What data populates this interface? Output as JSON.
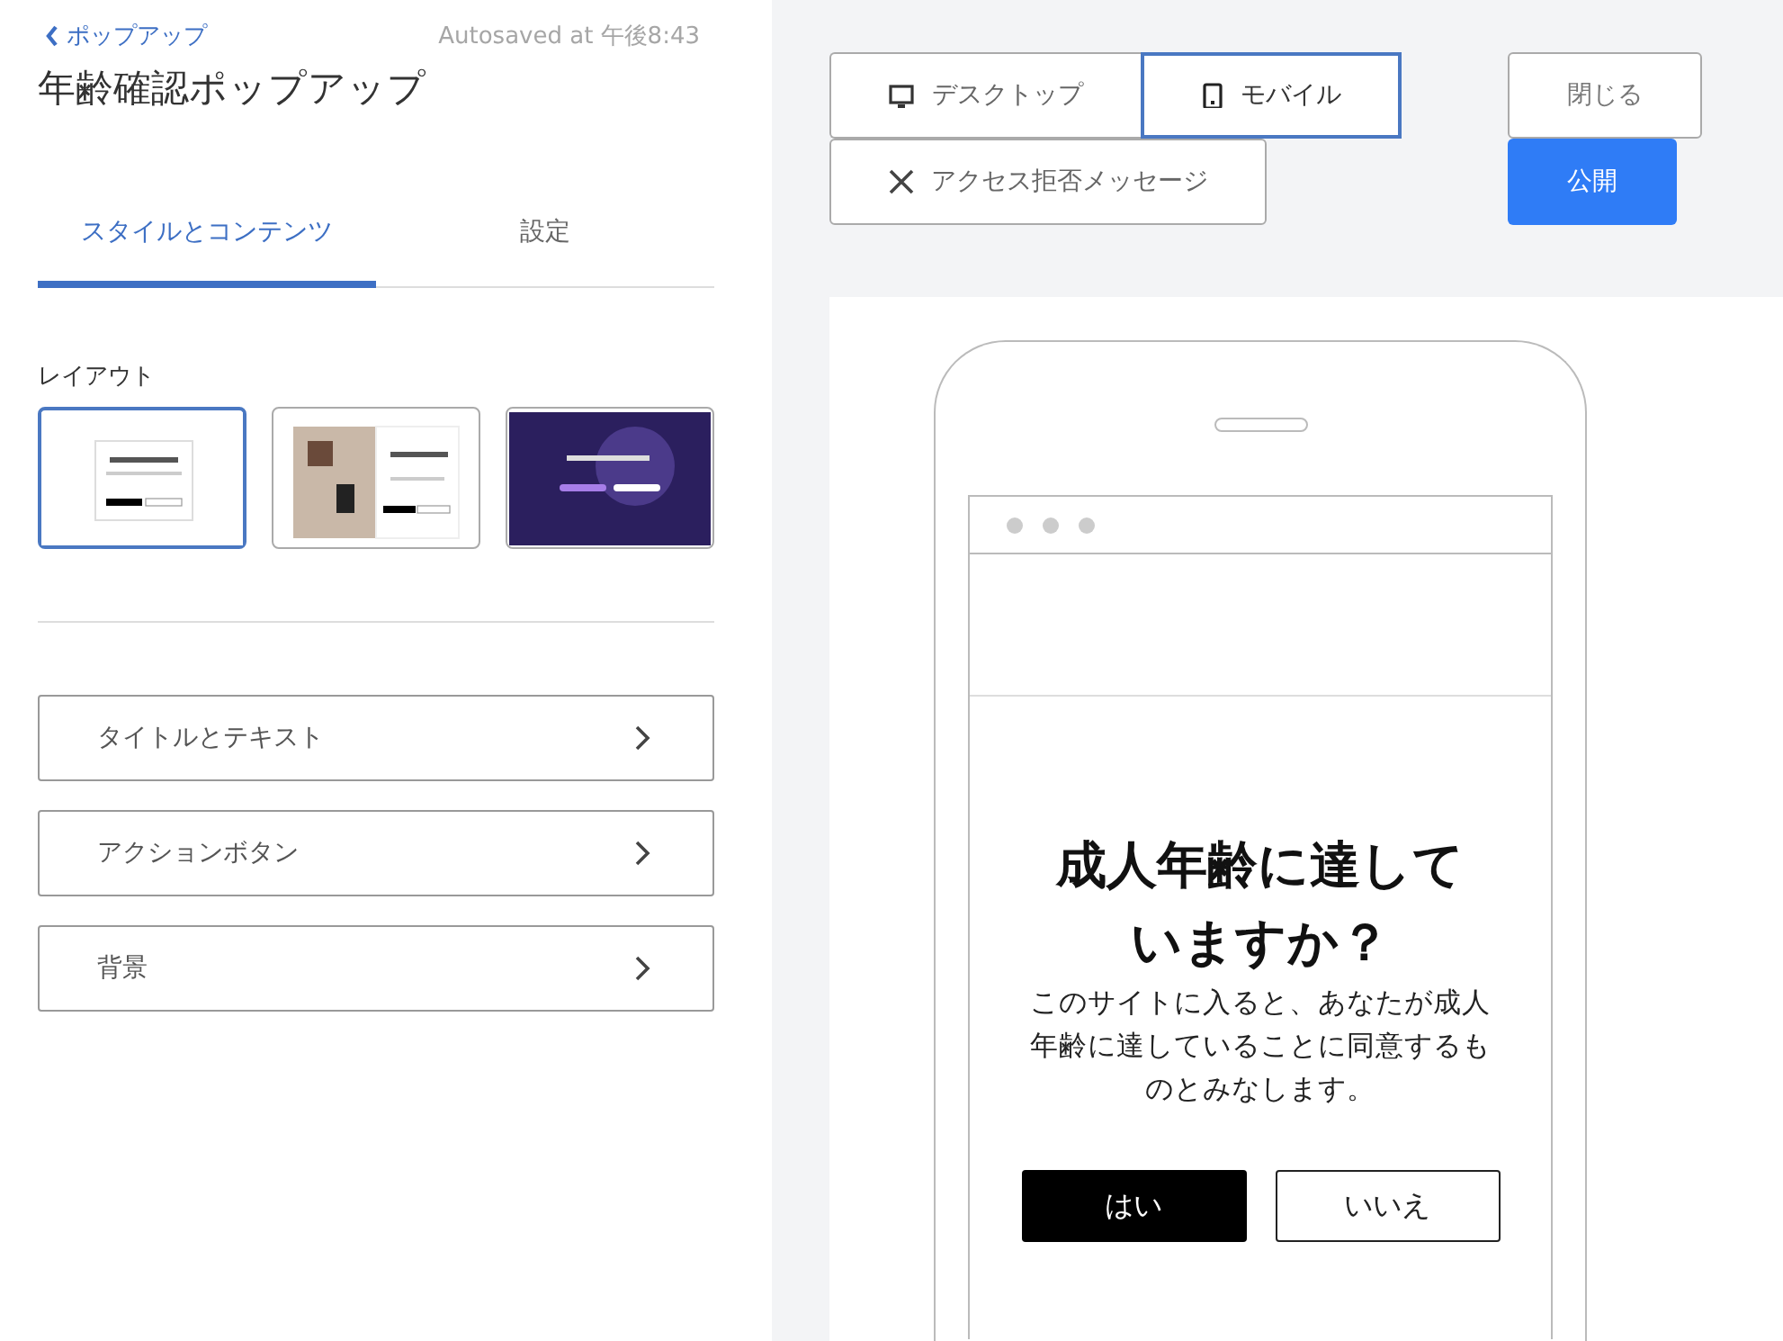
{
  "header": {
    "back_link": "ポップアップ",
    "autosave": "Autosaved at 午後8:43",
    "title": "年齢確認ポップアップ"
  },
  "tabs": [
    {
      "label": "スタイルとコンテンツ",
      "selected": true
    },
    {
      "label": "設定",
      "selected": false
    }
  ],
  "layout": {
    "label": "レイアウト",
    "options": [
      {
        "kind": "centered",
        "selected": true
      },
      {
        "kind": "split",
        "selected": false
      },
      {
        "kind": "fullscreen",
        "selected": false
      }
    ]
  },
  "sections": [
    {
      "label": "タイトルとテキスト"
    },
    {
      "label": "アクションボタン"
    },
    {
      "label": "背景"
    }
  ],
  "view_modes": [
    {
      "label": "デスクトップ",
      "kind": "desktop",
      "selected": false
    },
    {
      "label": "モバイル",
      "kind": "mobile",
      "selected": true
    },
    {
      "label": "アクセス拒否メッセージ",
      "kind": "denied",
      "selected": false
    }
  ],
  "actions": [
    {
      "label": "閉じる",
      "kind": "secondary"
    },
    {
      "label": "公開",
      "kind": "primary"
    }
  ],
  "preview": {
    "heading": "成人年齢に達していますか？",
    "body": "このサイトに入ると、あなたが成人年齢に達していることに同意するものとみなします。",
    "buttons": [
      {
        "label": "はい",
        "kind": "primary"
      },
      {
        "label": "いいえ",
        "kind": "secondary"
      }
    ]
  }
}
